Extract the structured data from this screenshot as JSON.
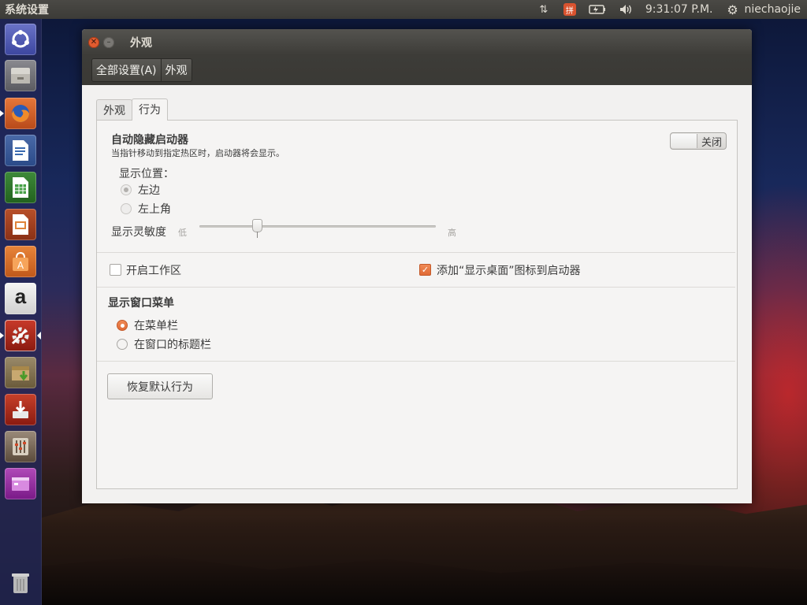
{
  "topbar": {
    "app_title": "系统设置",
    "clock": "9:31:07 P.M.",
    "username": "niechaojie",
    "icons": [
      "network-updown-icon",
      "input-method-icon",
      "battery-icon",
      "volume-icon",
      "gear-icon"
    ]
  },
  "launcher": {
    "items": [
      "ubuntu-dash-icon",
      "files-icon",
      "firefox-icon",
      "libreoffice-writer-icon",
      "libreoffice-calc-icon",
      "libreoffice-impress-icon",
      "software-center-icon",
      "amazon-icon",
      "system-settings-icon",
      "archive-manager-icon",
      "software-updater-icon",
      "unity-tweak-icon",
      "workspace-icon",
      "trash-icon"
    ],
    "amazon_letter": "a"
  },
  "window": {
    "title": "外观",
    "breadcrumbs": [
      "全部设置(A)",
      "外观"
    ],
    "tabs": [
      "外观",
      "行为"
    ],
    "active_tab": "行为"
  },
  "behavior": {
    "autohide_title": "自动隐藏启动器",
    "autohide_desc": "当指针移动到指定热区时，启动器将会显示。",
    "autohide_switch": "关闭",
    "reveal_location_label": "显示位置：",
    "reveal_left": "左边",
    "reveal_topleft": "左上角",
    "sensitivity_label": "显示灵敏度",
    "sensitivity_low": "低",
    "sensitivity_high": "高",
    "sensitivity_value": 0.24,
    "workspaces_label": "开启工作区",
    "workspaces_checked": false,
    "show_desktop_label": "添加“显示桌面”图标到启动器",
    "show_desktop_checked": true,
    "menu_title": "显示窗口菜单",
    "menu_in_bar": "在菜单栏",
    "menu_in_titlebar": "在窗口的标题栏",
    "menu_selected": "在菜单栏",
    "restore_button": "恢复默认行为"
  },
  "colors": {
    "accent": "#e06a35",
    "panel_dark": "#3c3b37",
    "launcher": "#23285a"
  }
}
